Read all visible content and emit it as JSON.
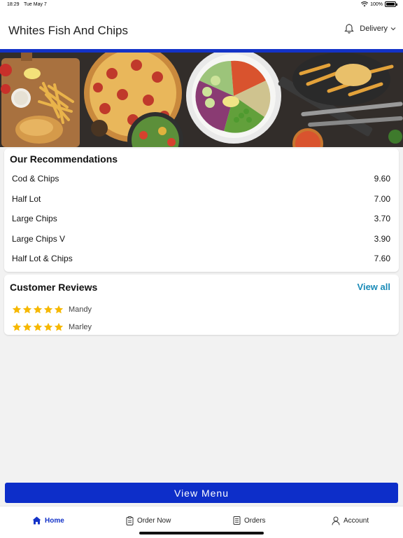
{
  "status_bar": {
    "time": "18:29",
    "date": "Tue May 7",
    "battery": "100%"
  },
  "header": {
    "title": "Whites Fish And Chips",
    "mode_label": "Delivery"
  },
  "colors": {
    "brand_blue": "#0d2ec9",
    "link_blue": "#1a8bb8",
    "star": "#f6b800"
  },
  "recommendations": {
    "title": "Our Recommendations",
    "items": [
      {
        "name": "Cod & Chips",
        "price": "9.60"
      },
      {
        "name": "Half Lot",
        "price": "7.00"
      },
      {
        "name": "Large Chips",
        "price": "3.70"
      },
      {
        "name": "Large Chips V",
        "price": "3.90"
      },
      {
        "name": "Half Lot & Chips",
        "price": "7.60"
      }
    ]
  },
  "reviews": {
    "title": "Customer Reviews",
    "view_all": "View all",
    "items": [
      {
        "name": "Mandy",
        "rating": 5
      },
      {
        "name": "Marley",
        "rating": 5
      }
    ]
  },
  "view_menu_label": "View Menu",
  "nav": {
    "items": [
      {
        "label": "Home",
        "icon": "home-icon",
        "active": true
      },
      {
        "label": "Order Now",
        "icon": "order-icon",
        "active": false
      },
      {
        "label": "Orders",
        "icon": "receipt-icon",
        "active": false
      },
      {
        "label": "Account",
        "icon": "user-icon",
        "active": false
      }
    ]
  }
}
